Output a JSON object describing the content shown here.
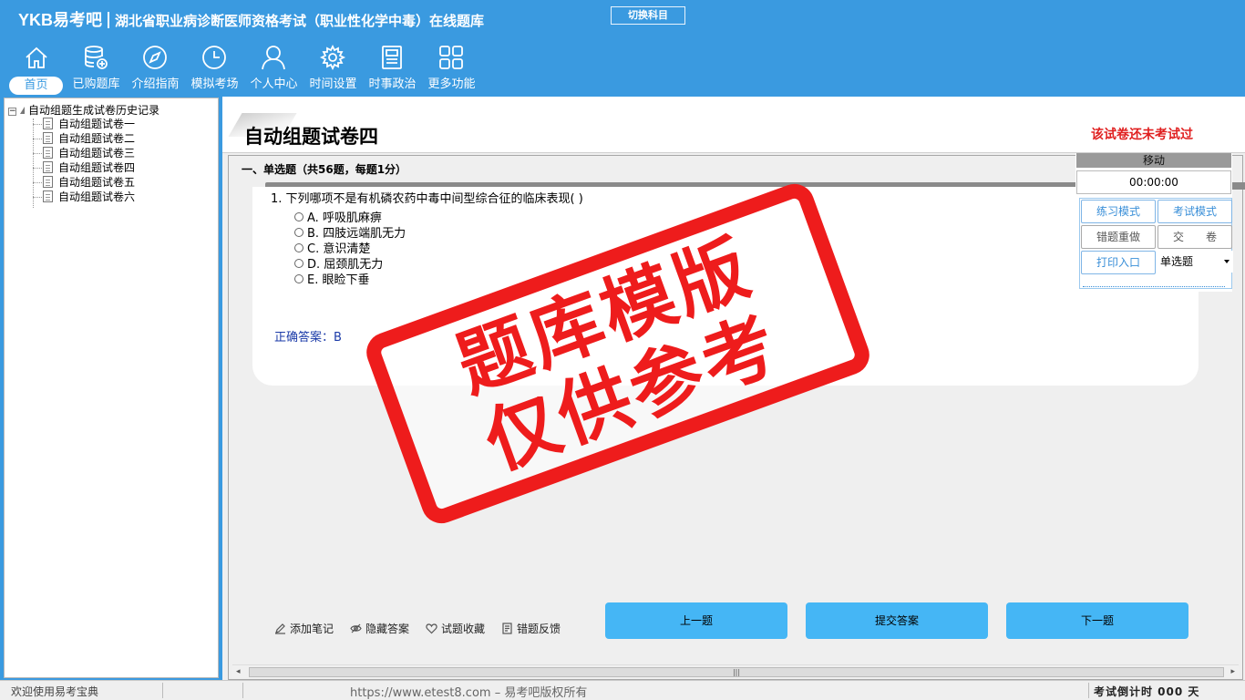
{
  "header": {
    "logo": "YKB易考吧",
    "title": "湖北省职业病诊断医师资格考试（职业性化学中毒）在线题库",
    "switch_subject": "切换科目"
  },
  "nav": [
    {
      "label": "首页",
      "icon": "home-icon"
    },
    {
      "label": "已购题库",
      "icon": "database-icon"
    },
    {
      "label": "介绍指南",
      "icon": "compass-icon"
    },
    {
      "label": "模拟考场",
      "icon": "clock-icon"
    },
    {
      "label": "个人中心",
      "icon": "user-icon"
    },
    {
      "label": "时间设置",
      "icon": "gear-icon"
    },
    {
      "label": "时事政治",
      "icon": "news-icon"
    },
    {
      "label": "更多功能",
      "icon": "grid-icon"
    }
  ],
  "tree": {
    "root": "自动组题生成试卷历史记录",
    "items": [
      "自动组题试卷一",
      "自动组题试卷二",
      "自动组题试卷三",
      "自动组题试卷四",
      "自动组题试卷五",
      "自动组题试卷六"
    ]
  },
  "paper": {
    "title": "自动组题试卷四",
    "status": "该试卷还未考试过",
    "section": "一、单选题（共56题，每题1分）"
  },
  "question": {
    "text": "1. 下列哪项不是有机磷农药中毒中间型综合征的临床表现(  )",
    "options": [
      "A. 呼吸肌麻痹",
      "B. 四肢远端肌无力",
      "C. 意识清楚",
      "D. 屈颈肌无力",
      "E. 眼睑下垂"
    ],
    "answer": "正确答案：B"
  },
  "tools": [
    "添加笔记",
    "隐藏答案",
    "试题收藏",
    "错题反馈"
  ],
  "buttons": {
    "prev": "上一题",
    "submit": "提交答案",
    "next": "下一题"
  },
  "control": {
    "move": "移动",
    "timer": "00:00:00",
    "practice_mode": "练习模式",
    "exam_mode": "考试模式",
    "redo_wrong": "错题重做",
    "hand_in": "交　　卷",
    "print": "打印入口",
    "type_select": "单选题"
  },
  "stamp": {
    "line1": "题库模版",
    "line2": "仅供参考"
  },
  "status": {
    "welcome": "欢迎使用易考宝典",
    "url": "https://www.etest8.com – 易考吧版权所有",
    "countdown": "考试倒计时 000 天"
  },
  "colors": {
    "primary": "#3a9ae0",
    "button": "#45b6f5",
    "alert": "#e02020",
    "stamp": "#ee1c1c"
  }
}
